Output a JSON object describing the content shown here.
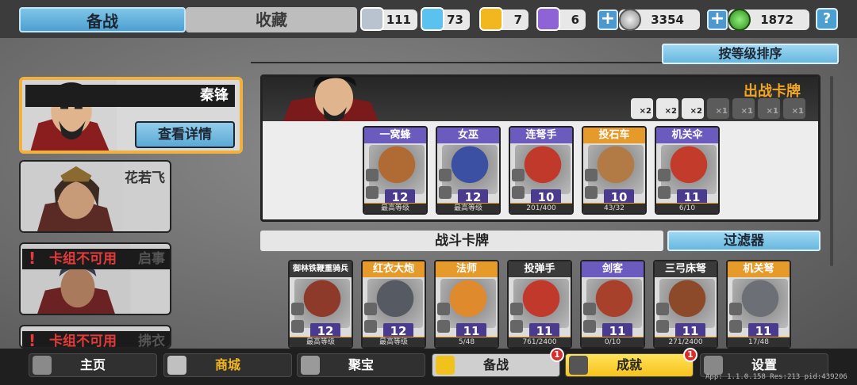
{
  "tabs": {
    "active": "备战",
    "inactive": "收藏"
  },
  "resources": [
    {
      "icon": "silver-shield-icon",
      "value": "111",
      "color": "#b8c3cf"
    },
    {
      "icon": "blue-crystal-icon",
      "value": "73",
      "color": "#5ac2ef"
    },
    {
      "icon": "gold-shield-icon",
      "value": "7",
      "color": "#f2b61f"
    },
    {
      "icon": "purple-shield-icon",
      "value": "6",
      "color": "#8e63d6"
    }
  ],
  "coins": {
    "silver": "3354",
    "jade": "1872"
  },
  "help_label": "?",
  "sort_label": "按等级排序",
  "heroes": {
    "selected_name": "秦锋",
    "detail_label": "查看详情",
    "hero2_name": "花若飞",
    "warn_label": "卡组不可用",
    "hero3_name": "启事",
    "hero4_name": "拂衣"
  },
  "deck": {
    "title": "出战卡牌",
    "type_slots": [
      {
        "icon": "gear-type-icon",
        "count": "×2",
        "active": true
      },
      {
        "icon": "crossed-swords-type-icon",
        "count": "×2",
        "active": true
      },
      {
        "icon": "helmet-type-icon",
        "count": "×2",
        "active": true
      },
      {
        "icon": "star-type-icon",
        "count": "×1",
        "active": false
      },
      {
        "icon": "ghost-type-icon",
        "count": "×1",
        "active": false
      },
      {
        "icon": "tower-type-icon",
        "count": "×1",
        "active": false
      },
      {
        "icon": "trident-type-icon",
        "count": "×1",
        "active": false
      }
    ],
    "cards": [
      {
        "name": "一窝蜂",
        "level": "12",
        "foot": "最高等级",
        "rarity": "#6b5bbf",
        "art": "#b06a34"
      },
      {
        "name": "女巫",
        "level": "12",
        "foot": "最高等级",
        "rarity": "#6b5bbf",
        "art": "#3b4fa3"
      },
      {
        "name": "连弩手",
        "level": "10",
        "foot": "201/400",
        "rarity": "#6b5bbf",
        "art": "#c0392b"
      },
      {
        "name": "投石车",
        "level": "10",
        "foot": "43/32",
        "rarity": "#e59a2a",
        "art": "#b27a44"
      },
      {
        "name": "机关伞",
        "level": "11",
        "foot": "6/10",
        "rarity": "#6b5bbf",
        "art": "#c23b2b"
      }
    ]
  },
  "battle": {
    "label": "战斗卡牌",
    "filter_label": "过滤器",
    "cards": [
      {
        "name": "御林铁鞭重骑兵",
        "level": "12",
        "foot": "最高等级",
        "rarity": "#3a3a3a",
        "art": "#8d3a2a"
      },
      {
        "name": "红衣大炮",
        "level": "12",
        "foot": "最高等级",
        "rarity": "#e59a2a",
        "art": "#555a63"
      },
      {
        "name": "法师",
        "level": "11",
        "foot": "5/48",
        "rarity": "#e59a2a",
        "art": "#e08a2e"
      },
      {
        "name": "投弹手",
        "level": "11",
        "foot": "761/2400",
        "rarity": "#3a3a3a",
        "art": "#c0392b"
      },
      {
        "name": "剑客",
        "level": "11",
        "foot": "0/10",
        "rarity": "#6b5bbf",
        "art": "#a8412b"
      },
      {
        "name": "三弓床弩",
        "level": "11",
        "foot": "271/2400",
        "rarity": "#3a3a3a",
        "art": "#8d4a2a"
      },
      {
        "name": "机关弩",
        "level": "11",
        "foot": "17/48",
        "rarity": "#e59a2a",
        "art": "#6c6f75"
      }
    ]
  },
  "nav": [
    {
      "label": "主页",
      "icon": "home-icon"
    },
    {
      "label": "商城",
      "icon": "shop-icon"
    },
    {
      "label": "聚宝",
      "icon": "treasure-icon"
    },
    {
      "label": "备战",
      "icon": "deck-icon",
      "badge": "1"
    },
    {
      "label": "成就",
      "icon": "achievement-icon",
      "badge": "1"
    },
    {
      "label": "设置",
      "icon": "settings-icon"
    }
  ],
  "version": "App: 1.1.0.158 Res:213 pid:439206"
}
